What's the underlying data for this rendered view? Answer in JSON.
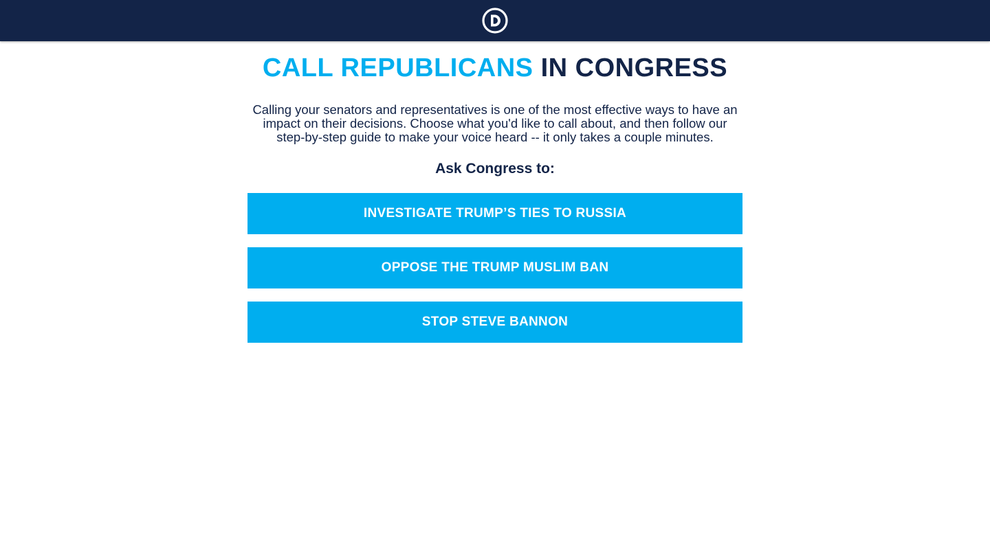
{
  "header": {
    "logo_icon": "dnc-d-logo-icon",
    "logo_letter": "D",
    "background": "#132448"
  },
  "page": {
    "title_accent": "CALL REPUBLICANS",
    "title_rest": " IN CONGRESS",
    "intro": "Calling your senators and representatives is one of the most effective ways to have an impact on their decisions. Choose what you'd like to call about, and then follow our step-by-step guide to make your voice heard -- it only takes a couple minutes.",
    "ask_heading": "Ask Congress to:"
  },
  "actions": [
    {
      "label": "INVESTIGATE TRUMP’S TIES TO RUSSIA"
    },
    {
      "label": "OPPOSE THE TRUMP MUSLIM BAN"
    },
    {
      "label": "STOP STEVE BANNON"
    }
  ],
  "colors": {
    "accent": "#00aeef",
    "navy": "#132448",
    "button_text": "#ffffff"
  }
}
